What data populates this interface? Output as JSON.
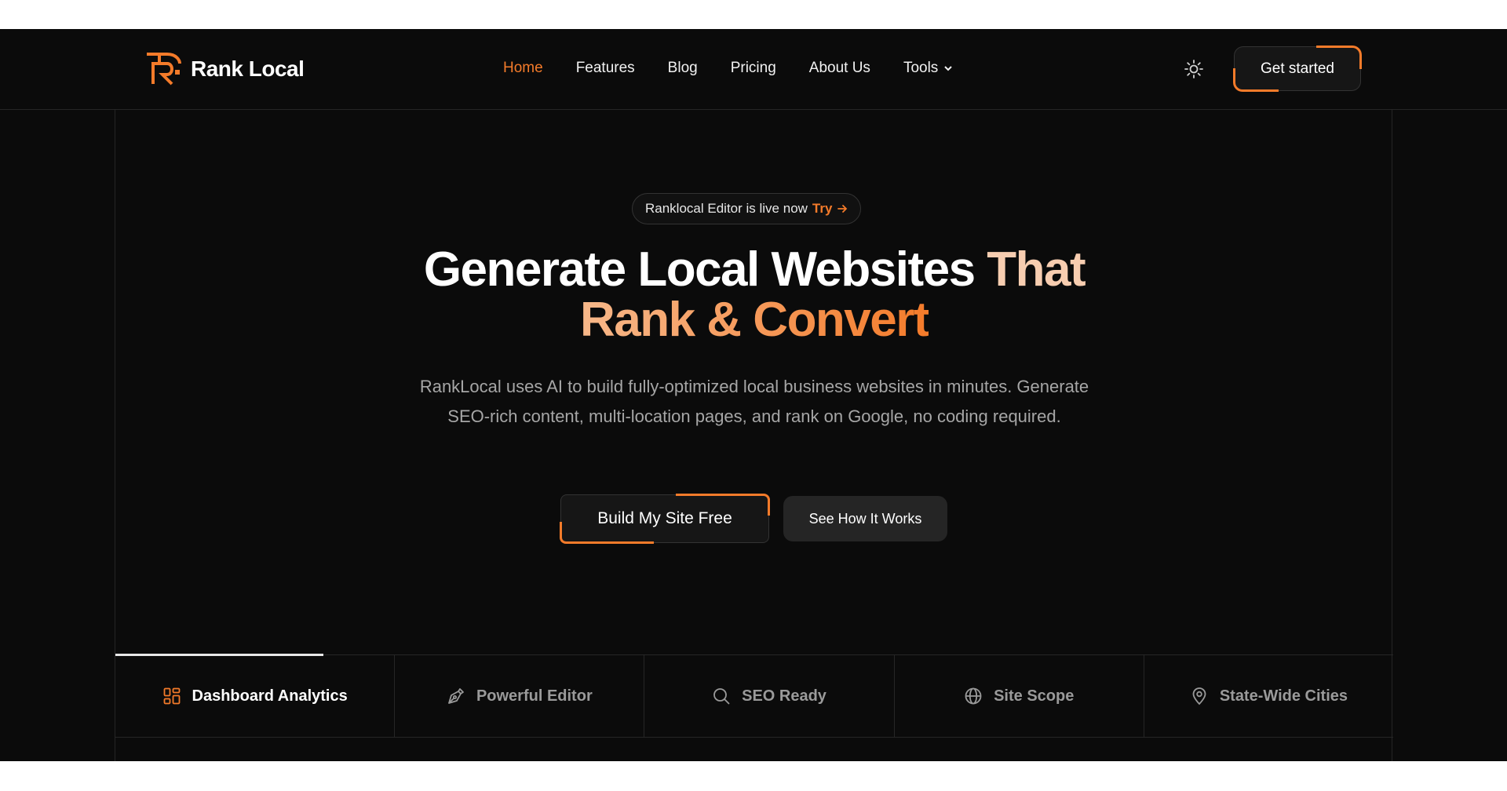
{
  "brand": {
    "name": "Rank Local",
    "accent_color": "#f47b2a"
  },
  "nav": {
    "items": [
      {
        "label": "Home",
        "active": true
      },
      {
        "label": "Features"
      },
      {
        "label": "Blog"
      },
      {
        "label": "Pricing"
      },
      {
        "label": "About Us"
      },
      {
        "label": "Tools",
        "has_dropdown": true
      }
    ],
    "theme_icon": "sun-icon",
    "cta_label": "Get started"
  },
  "hero": {
    "announcement": {
      "text": "Ranklocal Editor is live now",
      "link_label": "Try"
    },
    "headline_line1_a": "Generate Local Websites",
    "headline_line1_b": "That",
    "headline_line2": "Rank & Convert",
    "subtext": "RankLocal uses AI to build fully-optimized local business websites in minutes. Generate SEO-rich content, multi-location pages, and rank on Google, no coding required.",
    "primary_cta": "Build My Site Free",
    "secondary_cta": "See How It Works"
  },
  "features": {
    "tabs": [
      {
        "label": "Dashboard Analytics",
        "icon": "dashboard-icon",
        "active": true
      },
      {
        "label": "Powerful Editor",
        "icon": "pen-icon"
      },
      {
        "label": "SEO Ready",
        "icon": "search-icon"
      },
      {
        "label": "Site Scope",
        "icon": "globe-icon"
      },
      {
        "label": "State-Wide Cities",
        "icon": "map-pin-icon"
      }
    ]
  }
}
